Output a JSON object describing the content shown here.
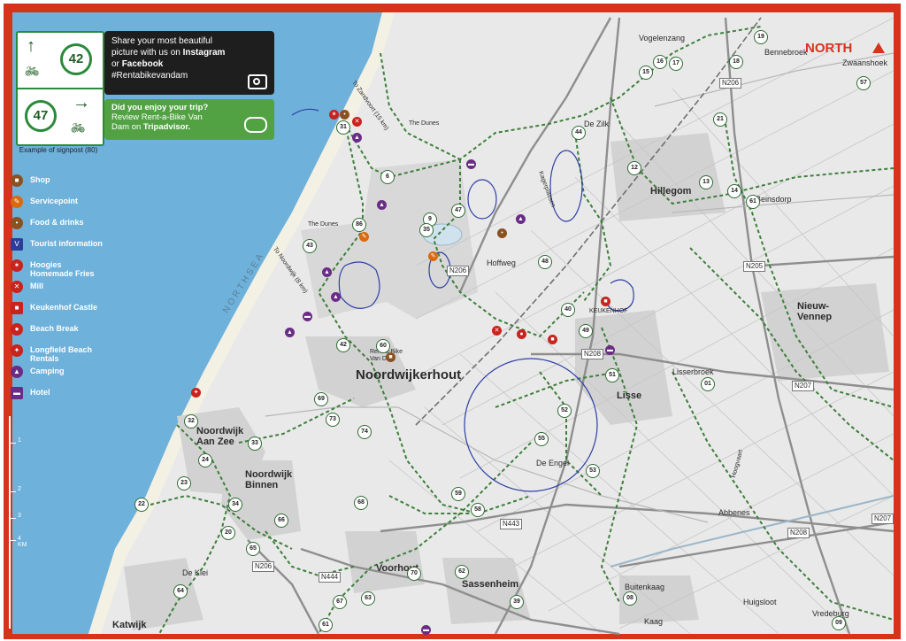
{
  "colors": {
    "frame": "#d6331d",
    "sea": "#6eb1da",
    "land": "#e9e9e9",
    "route": "#3d7f3a",
    "ink": "#2d3fa5",
    "instagram_box": "#1e1e1e",
    "tripadvisor_box": "#52a244"
  },
  "legend": {
    "signpost": {
      "top_number": "42",
      "top_arrow": "↑",
      "bottom_number": "47",
      "bottom_arrow": "→",
      "bike_icon": "bicycle-icon"
    },
    "signpost_caption": "Example of signpost (80)",
    "items": [
      {
        "label": "Shop",
        "icon": "shop-icon",
        "color": "#8a5220"
      },
      {
        "label": "Servicepoint",
        "icon": "wrench-icon",
        "color": "#d86a10"
      },
      {
        "label": "Food & drinks",
        "icon": "food-icon",
        "color": "#8a5220"
      },
      {
        "label": "Tourist information",
        "icon": "info-icon",
        "color": "#2b3f9a"
      },
      {
        "label": "Hoogies Homemade Fries",
        "icon": "fries-icon",
        "color": "#c8231c"
      },
      {
        "label": "Mill",
        "icon": "windmill-icon",
        "color": "#c8231c"
      },
      {
        "label": "Keukenhof Castle",
        "icon": "castle-icon",
        "color": "#c8231c"
      },
      {
        "label": "Beach Break",
        "icon": "beach-icon",
        "color": "#c8231c"
      },
      {
        "label": "Longfield Beach Rentals",
        "icon": "surf-icon",
        "color": "#c8231c"
      },
      {
        "label": "Camping",
        "icon": "tent-icon",
        "color": "#6a2c86"
      },
      {
        "label": "Hotel",
        "icon": "bed-icon",
        "color": "#6a2c86"
      }
    ],
    "scale": {
      "ticks": [
        "1",
        "2",
        "3",
        "4 KM"
      ]
    }
  },
  "instagram_box": {
    "line1": "Share your most beautiful",
    "line2": "picture with us on",
    "instagram": "Instagram",
    "line3": "or",
    "facebook": "Facebook",
    "hashtag": "#Rentabikevandam",
    "icon": "camera-icon"
  },
  "tripadvisor_box": {
    "heading": "Did you enjoy your trip?",
    "line1": "Review Rent-a-Bike Van",
    "line2": "Dam on",
    "brand": "Tripadvisor.",
    "icon": "tripadvisor-owl-icon"
  },
  "compass": {
    "label": "NORTH"
  },
  "map": {
    "sea_label": "NORTHSEA",
    "towns": [
      {
        "name": "Noordwijkerhout",
        "size": "big"
      },
      {
        "name": "Noordwijk Aan Zee",
        "size": "normal"
      },
      {
        "name": "Noordwijk Binnen",
        "size": "normal"
      },
      {
        "name": "Hillegom",
        "size": "normal"
      },
      {
        "name": "Lisse",
        "size": "normal"
      },
      {
        "name": "Nieuw-Vennep",
        "size": "normal"
      },
      {
        "name": "Voorhout",
        "size": "normal"
      },
      {
        "name": "Sassenheim",
        "size": "normal"
      },
      {
        "name": "Katwijk",
        "size": "normal"
      }
    ],
    "places": [
      "Vogelenzang",
      "Bennebroek",
      "Zwaanshoek",
      "De Zilk",
      "Beinsdorp",
      "Lisserbroek",
      "Abbenes",
      "Buitenkaag",
      "Huigsloot",
      "Kaag",
      "Vredeburg",
      "De Engel",
      "Hoffweg",
      "De Klei",
      "The Dunes",
      "The Dunes",
      "Rent-a-Bike Van Dam",
      "KEUKENHOF",
      "Kagerplassen",
      "Hoogvaart"
    ],
    "pointers": [
      "To Zandvoort (15 km)",
      "To Noordwijk (8 km)"
    ],
    "roads": [
      "N206",
      "N206",
      "N208",
      "N205",
      "N207",
      "N208",
      "N443",
      "N444",
      "N206",
      "N207"
    ],
    "nodes": [
      "15",
      "16",
      "17",
      "18",
      "19",
      "44",
      "21",
      "12",
      "13",
      "14",
      "61",
      "57",
      "31",
      "6",
      "9",
      "47",
      "35",
      "86",
      "43",
      "42",
      "48",
      "40",
      "49",
      "60",
      "51",
      "52",
      "53",
      "55",
      "57",
      "32",
      "33",
      "69",
      "73",
      "74",
      "59",
      "58",
      "22",
      "23",
      "24",
      "20",
      "34",
      "64",
      "65",
      "66",
      "67",
      "61",
      "39",
      "62",
      "63",
      "08",
      "09",
      "10",
      "01",
      "70",
      "68",
      "71"
    ]
  }
}
